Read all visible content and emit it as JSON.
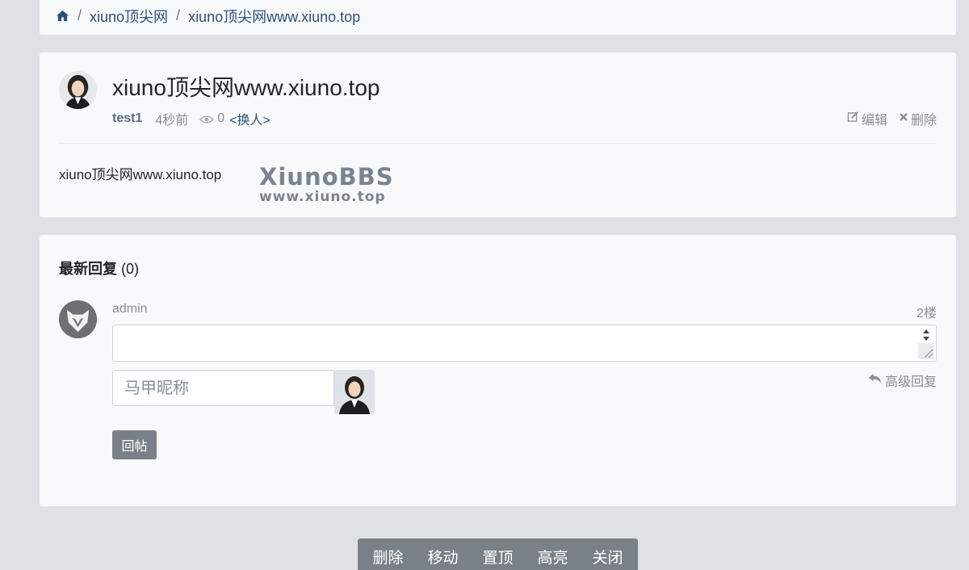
{
  "breadcrumb": {
    "items": [
      "xiuno顶尖网",
      "xiuno顶尖网www.xiuno.top"
    ]
  },
  "thread": {
    "title": "xiuno顶尖网www.xiuno.top",
    "author": "test1",
    "time": "4秒前",
    "views": "0",
    "change_label": "<换人>",
    "edit_label": "编辑",
    "delete_label": "删除",
    "content": "xiuno顶尖网www.xiuno.top",
    "watermark_main": "XiunoBBS",
    "watermark_sub": "www.xiuno.top"
  },
  "reply": {
    "heading": "最新回复",
    "count": "(0)",
    "user": "admin",
    "floor": "2楼",
    "nickname_placeholder": "马甲昵称",
    "advanced_label": "高级回复",
    "submit_label": "回帖"
  },
  "modbar": {
    "buttons": [
      "删除",
      "移动",
      "置顶",
      "高亮",
      "关闭"
    ]
  },
  "colors": {
    "link": "#2b4f7c",
    "muted": "#868e96",
    "button": "#7a8088",
    "background": "#dee2e6",
    "card": "#f8f9fa"
  },
  "icons": [
    "home-icon",
    "eye-icon",
    "edit-icon",
    "close-icon",
    "reply-arrow-icon"
  ]
}
